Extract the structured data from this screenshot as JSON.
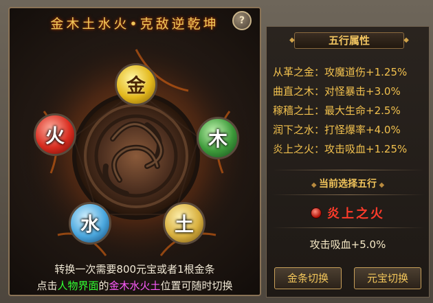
{
  "left": {
    "title": "金木土水火•克敌逆乾坤",
    "help_label": "?",
    "orbs": {
      "metal": "金",
      "wood": "木",
      "fire": "火",
      "water": "水",
      "earth": "土"
    },
    "info_line1": "转换一次需要800元宝或者1根金条",
    "info_line2": {
      "prefix": "点击",
      "highlight1": "人物界面",
      "middle": "的",
      "highlight2": "金木水火土",
      "suffix": "位置可随时切换"
    }
  },
  "right": {
    "header": "五行属性",
    "attributes": [
      {
        "name": "从革之金：",
        "value": "攻魔道伤+1.25%"
      },
      {
        "name": "曲直之木：",
        "value": "对怪暴击+3.0%"
      },
      {
        "name": "稼穑之土：",
        "value": "最大生命+2.5%"
      },
      {
        "name": "润下之水：",
        "value": "打怪爆率+4.0%"
      },
      {
        "name": "炎上之火：",
        "value": "攻击吸血+1.25%"
      }
    ],
    "selected_title": "当前选择五行",
    "selected_element": "炎上之火",
    "selected_bonus": "攻击吸血+5.0%",
    "btn_gold": "金条切换",
    "btn_yuanbao": "元宝切换"
  },
  "colors": {
    "gold_text": "#f2c14e",
    "selected_red": "#ff3b2a",
    "highlight_green": "#32ff32",
    "highlight_purple": "#ff5cff"
  }
}
